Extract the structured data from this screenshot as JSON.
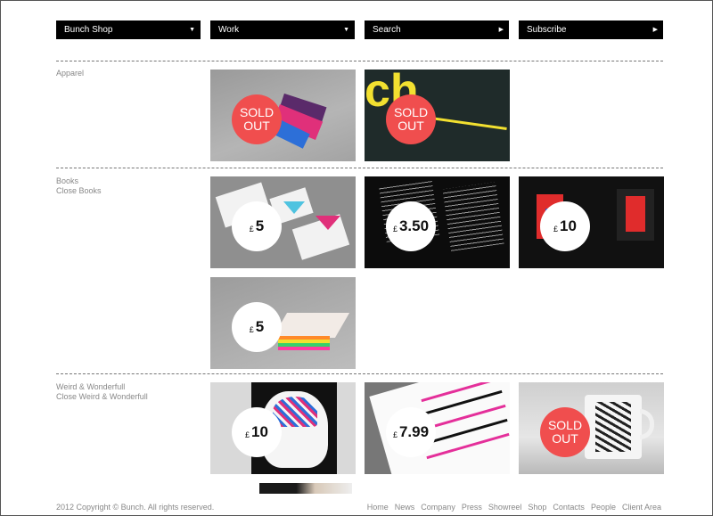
{
  "nav": [
    {
      "label": "Bunch Shop",
      "arrow": "▼"
    },
    {
      "label": "Work",
      "arrow": "▼"
    },
    {
      "label": "Search",
      "arrow": "▶"
    },
    {
      "label": "Subscribe",
      "arrow": "▶"
    }
  ],
  "sections": [
    {
      "name": "Apparel",
      "close": ""
    },
    {
      "name": "Books",
      "close": "Close Books"
    },
    {
      "name": "Weird & Wonderfull",
      "close": "Close Weird & Wonderfull"
    }
  ],
  "products": [
    {
      "badge_type": "sold",
      "badge_text": "SOLD OUT",
      "currency": "",
      "price": "",
      "art_word": ""
    },
    {
      "badge_type": "sold",
      "badge_text": "SOLD OUT",
      "currency": "",
      "price": "",
      "art_word": "ch"
    },
    {
      "badge_type": "price",
      "badge_text": "",
      "currency": "£",
      "price": "5",
      "art_word": ""
    },
    {
      "badge_type": "price",
      "badge_text": "",
      "currency": "£",
      "price": "3.50",
      "art_word": ""
    },
    {
      "badge_type": "price",
      "badge_text": "",
      "currency": "£",
      "price": "10",
      "art_word": ""
    },
    {
      "badge_type": "price",
      "badge_text": "",
      "currency": "£",
      "price": "5",
      "art_word": ""
    },
    {
      "badge_type": "price",
      "badge_text": "",
      "currency": "£",
      "price": "10",
      "art_word": ""
    },
    {
      "badge_type": "price",
      "badge_text": "",
      "currency": "£",
      "price": "7.99",
      "art_word": ""
    },
    {
      "badge_type": "sold",
      "badge_text": "SOLD OUT",
      "currency": "",
      "price": "",
      "art_word": ""
    }
  ],
  "footer": {
    "copyright": "2012 Copyright © Bunch. All rights reserved.",
    "links": [
      "Home",
      "News",
      "Company",
      "Press",
      "Showreel",
      "Shop",
      "Contacts",
      "People",
      "Client Area"
    ]
  }
}
